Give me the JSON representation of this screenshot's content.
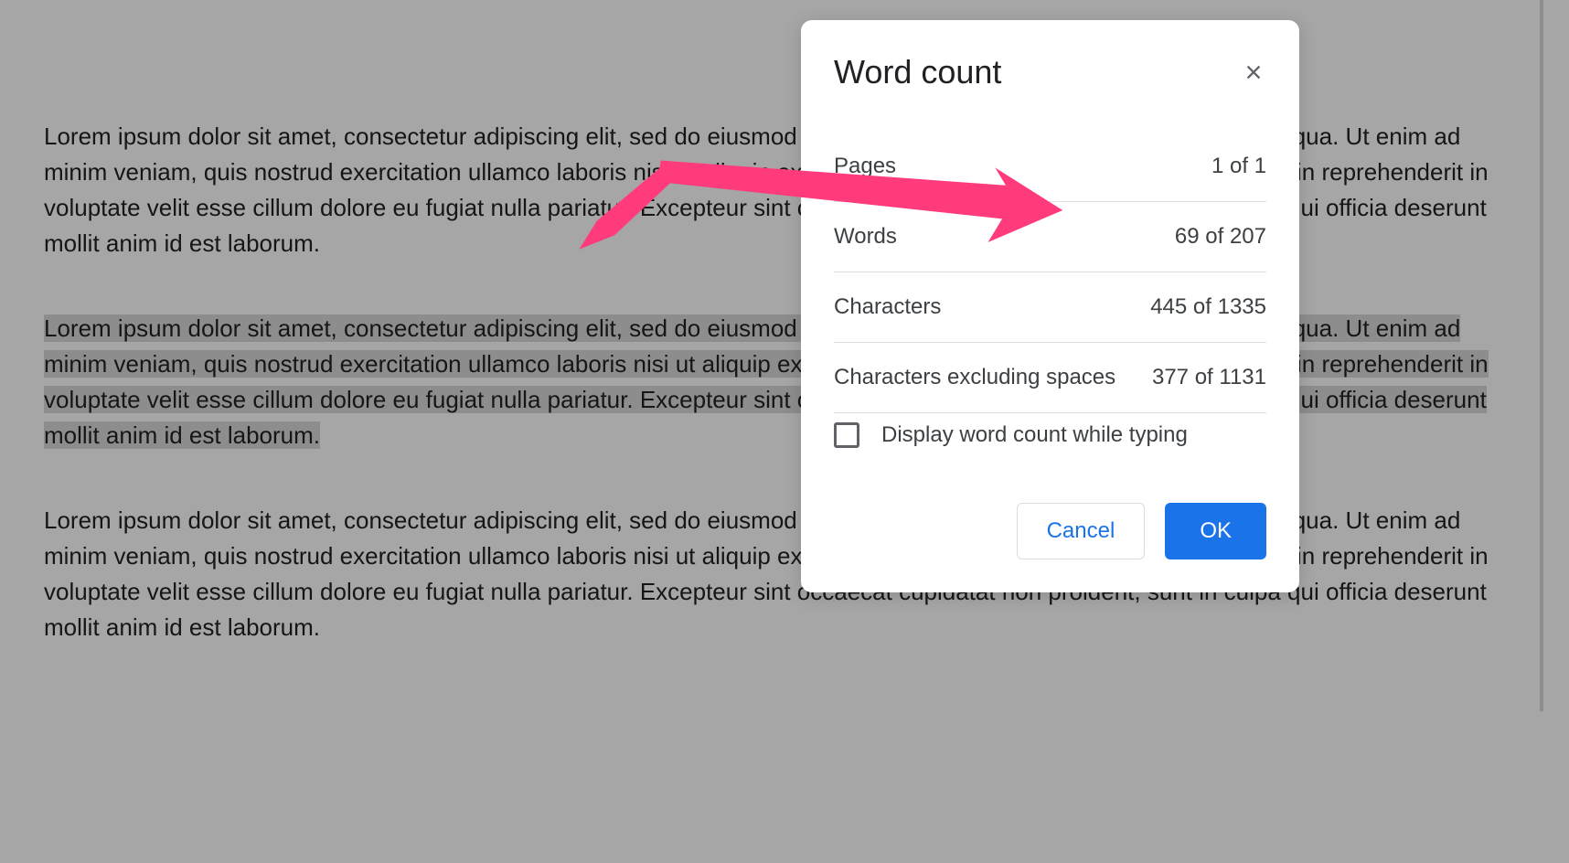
{
  "document": {
    "paragraphs": [
      "Lorem ipsum dolor sit amet, consectetur adipiscing elit, sed do eiusmod tempor incididunt ut labore et dolore magna aliqua. Ut enim ad minim veniam, quis nostrud exercitation ullamco laboris nisi ut aliquip ex ea commodo consequat. Duis aute irure dolor in reprehenderit in voluptate velit esse cillum dolore eu fugiat nulla pariatur. Excepteur sint occaecat cupidatat non proident, sunt in culpa qui officia deserunt mollit anim id est laborum.",
      "Lorem ipsum dolor sit amet, consectetur adipiscing elit, sed do eiusmod tempor incididunt ut labore et dolore magna aliqua. Ut enim ad minim veniam, quis nostrud exercitation ullamco laboris nisi ut aliquip ex ea commodo consequat. Duis aute irure dolor in reprehenderit in voluptate velit esse cillum dolore eu fugiat nulla pariatur. Excepteur sint occaecat cupidatat non proident, sunt in culpa qui officia deserunt mollit anim id est laborum.",
      "Lorem ipsum dolor sit amet, consectetur adipiscing elit, sed do eiusmod tempor incididunt ut labore et dolore magna aliqua. Ut enim ad minim veniam, quis nostrud exercitation ullamco laboris nisi ut aliquip ex ea commodo consequat. Duis aute irure dolor in reprehenderit in voluptate velit esse cillum dolore eu fugiat nulla pariatur. Excepteur sint occaecat cupidatat non proident, sunt in culpa qui officia deserunt mollit anim id est laborum."
    ],
    "selected_paragraph_index": 1
  },
  "dialog": {
    "title": "Word count",
    "stats": [
      {
        "label": "Pages",
        "value": "1 of 1"
      },
      {
        "label": "Words",
        "value": "69 of 207"
      },
      {
        "label": "Characters",
        "value": "445 of 1335"
      },
      {
        "label": "Characters excluding spaces",
        "value": "377 of 1131"
      }
    ],
    "checkbox_label": "Display word count while typing",
    "checkbox_checked": false,
    "cancel_label": "Cancel",
    "ok_label": "OK"
  },
  "annotation": {
    "color": "#ff3b7b"
  }
}
